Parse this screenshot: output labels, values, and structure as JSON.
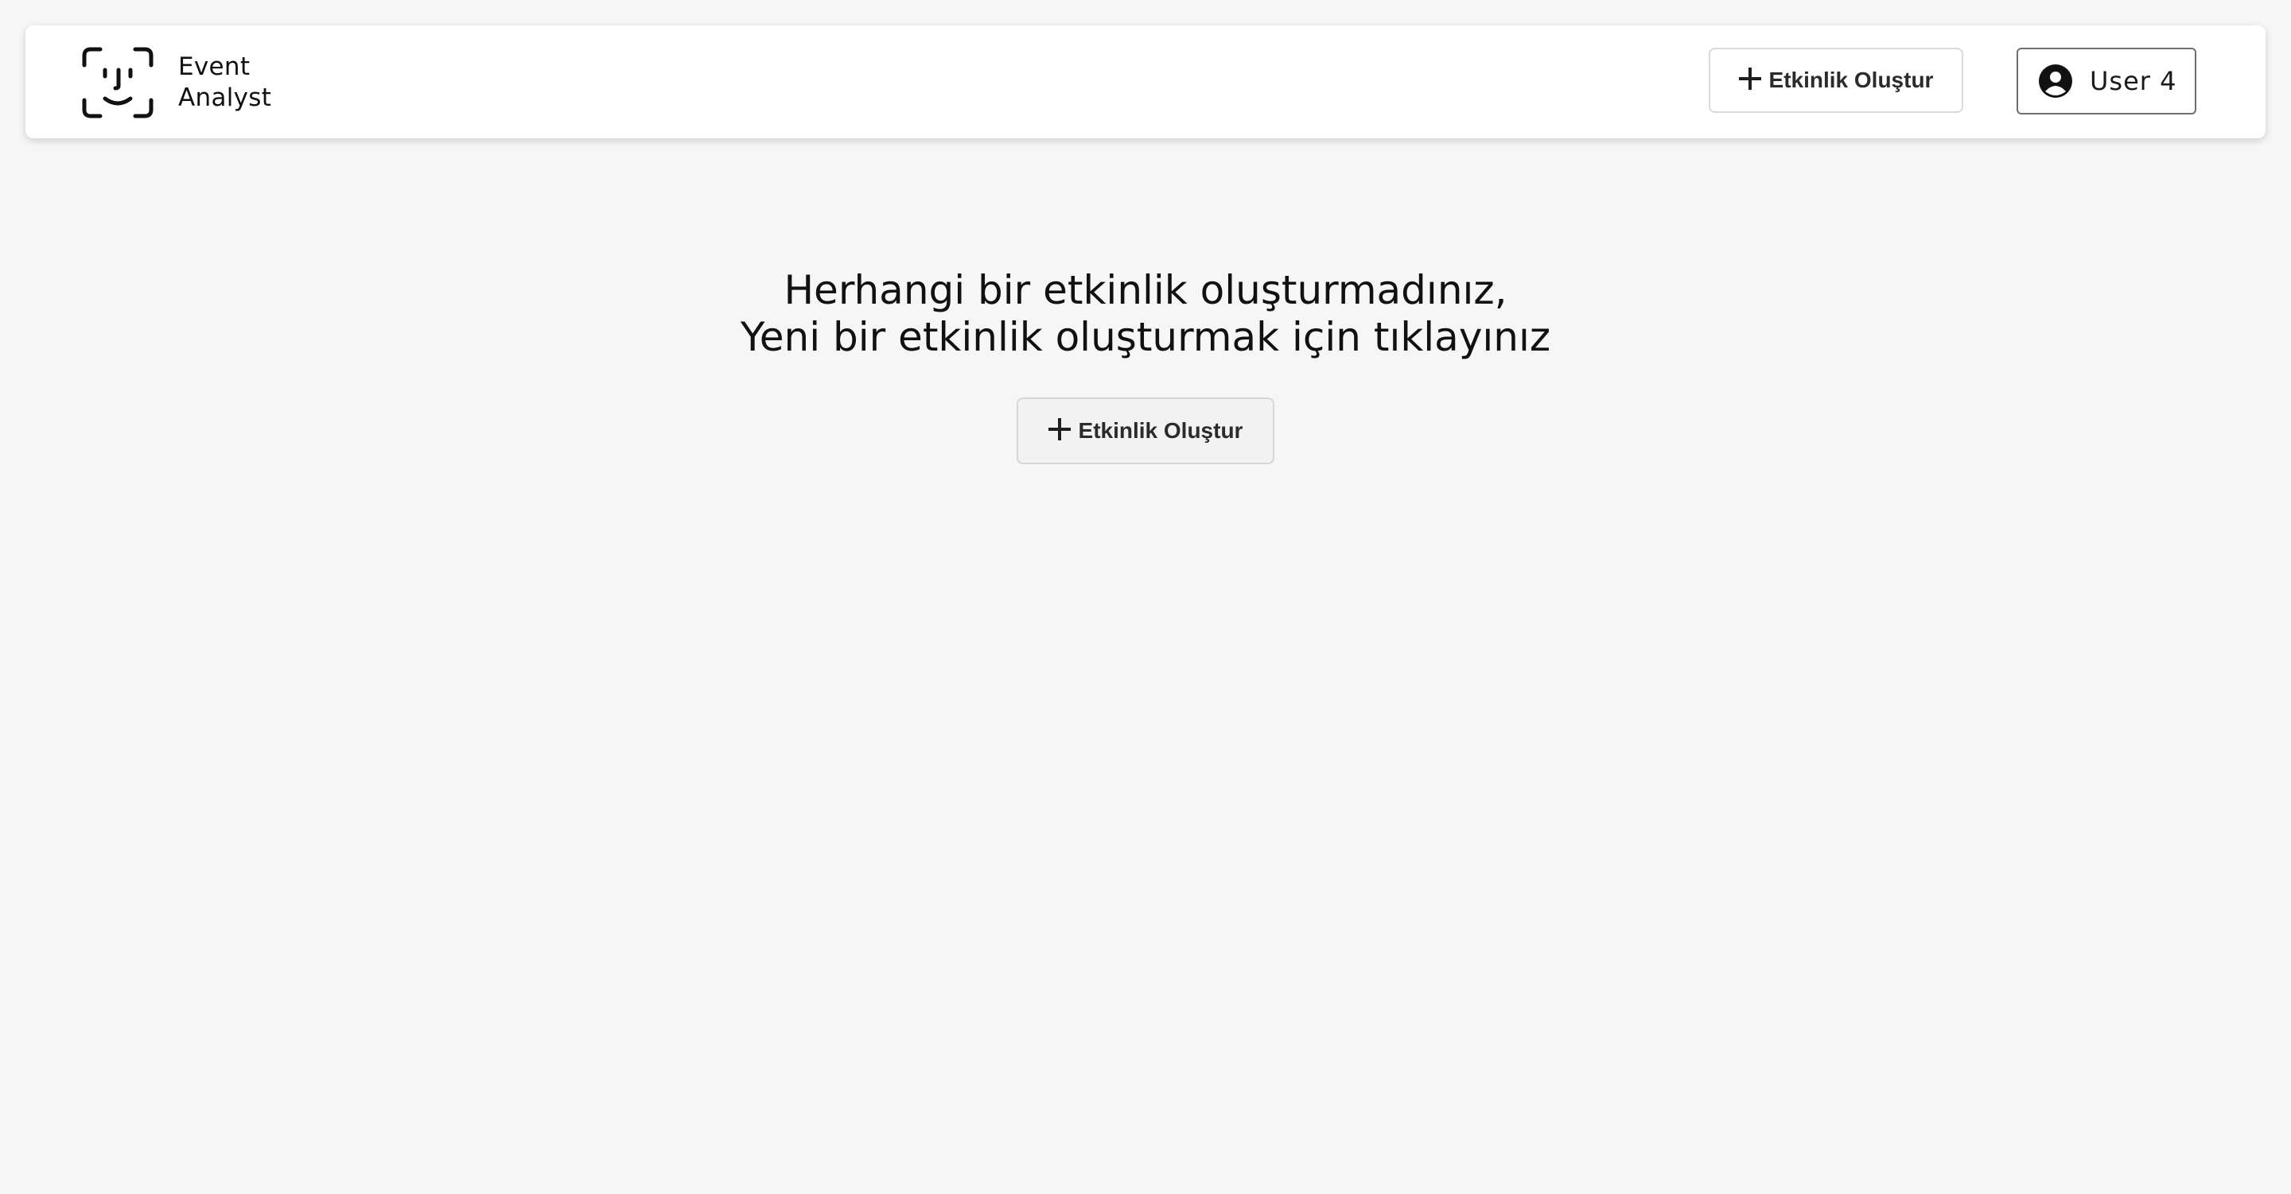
{
  "brand": {
    "line1": "Event",
    "line2": "Analyst",
    "icon": "face-id-icon"
  },
  "header": {
    "create_button_label": "Etkinlik Oluştur",
    "user_label": "User 4",
    "user_icon": "user-circle-icon"
  },
  "empty_state": {
    "line1": "Herhangi bir etkinlik oluşturmadınız,",
    "line2": "Yeni bir etkinlik oluşturmak için tıklayınız",
    "button_label": "Etkinlik Oluştur"
  },
  "colors": {
    "page_background": "#f6f6f6",
    "navbar_background": "#ffffff",
    "text": "#111111"
  }
}
